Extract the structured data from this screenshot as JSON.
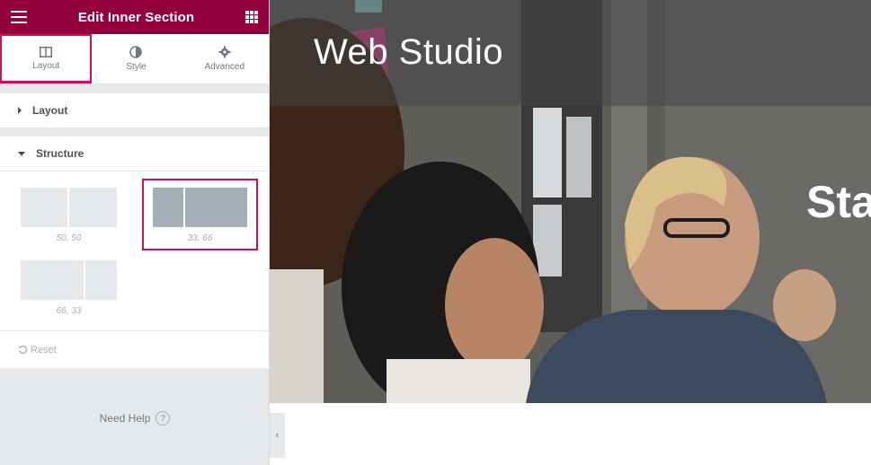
{
  "panel": {
    "title": "Edit Inner Section",
    "tabs": [
      {
        "label": "Layout",
        "icon": "columns-icon",
        "active": true
      },
      {
        "label": "Style",
        "icon": "contrast-icon",
        "active": false
      },
      {
        "label": "Advanced",
        "icon": "gear-icon",
        "active": false
      }
    ],
    "sections": {
      "layout": {
        "label": "Layout",
        "expanded": false
      },
      "structure": {
        "label": "Structure",
        "expanded": true
      }
    },
    "structure_presets": [
      {
        "label": "50, 50",
        "selected": false
      },
      {
        "label": "33, 66",
        "selected": true
      },
      {
        "label": "66, 33",
        "selected": false
      }
    ],
    "reset_label": "Reset",
    "help_label": "Need Help",
    "help_icon_glyph": "?"
  },
  "canvas": {
    "site_title": "Web Studio",
    "hero_text_partial": "Sta",
    "collapse_glyph": "‹"
  },
  "colors": {
    "brand": "#93003c",
    "accent": "#d30c5c",
    "panel_bg": "#e6e9ec"
  }
}
